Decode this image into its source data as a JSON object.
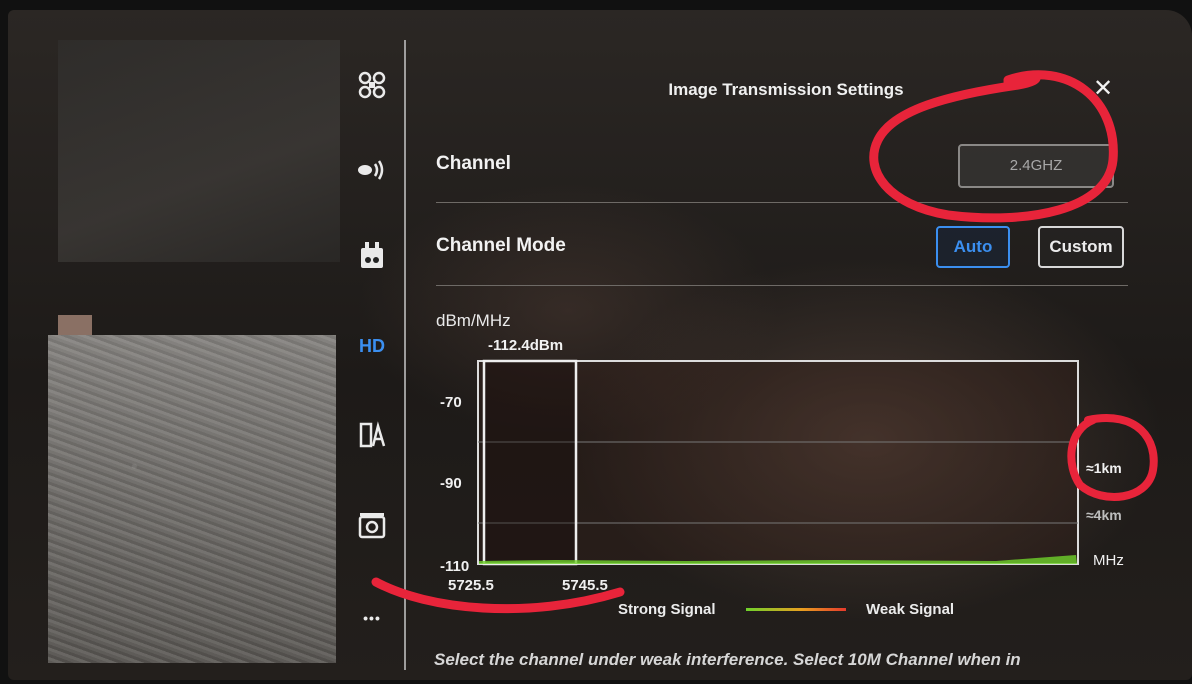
{
  "header": {
    "title": "Image Transmission Settings",
    "close_icon": "close-icon"
  },
  "sidebar": {
    "items": [
      {
        "name": "aircraft",
        "icon": "aircraft-icon",
        "label": ""
      },
      {
        "name": "remote-controller",
        "icon": "signal-icon",
        "label": ""
      },
      {
        "name": "battery",
        "icon": "battery-icon",
        "label": ""
      },
      {
        "name": "hd",
        "icon": "hd-icon",
        "label": "HD",
        "active": true
      },
      {
        "name": "general",
        "icon": "general-icon",
        "label": ""
      },
      {
        "name": "camera",
        "icon": "camera-icon",
        "label": ""
      },
      {
        "name": "more",
        "icon": "more-icon",
        "label": "•••"
      }
    ],
    "accent": "#3b8ff0"
  },
  "settings": {
    "channel": {
      "label": "Channel",
      "value": "2.4GHZ"
    },
    "channel_mode": {
      "label": "Channel Mode",
      "options": [
        "Auto",
        "Custom"
      ],
      "selected": "Auto"
    }
  },
  "chart_data": {
    "type": "area",
    "ylabel": "dBm/MHz",
    "xlabel": "MHz",
    "marker_label": "-112.4dBm",
    "yticks": [
      "-70",
      "-90",
      "-110"
    ],
    "ylim": [
      -110,
      -60
    ],
    "xticks": [
      "5725.5",
      "5745.5"
    ],
    "range_labels": [
      "≈1km",
      "≈4km"
    ],
    "selected_channel": [
      5725.5,
      5745.5
    ],
    "grid": true,
    "legend": [
      {
        "name": "Strong Signal",
        "color": "#6fd22b"
      },
      {
        "name": "Weak Signal",
        "color": "#e63a2c"
      }
    ]
  },
  "footer": {
    "hint": "Select the channel under weak interference. Select 10M Channel when in"
  }
}
